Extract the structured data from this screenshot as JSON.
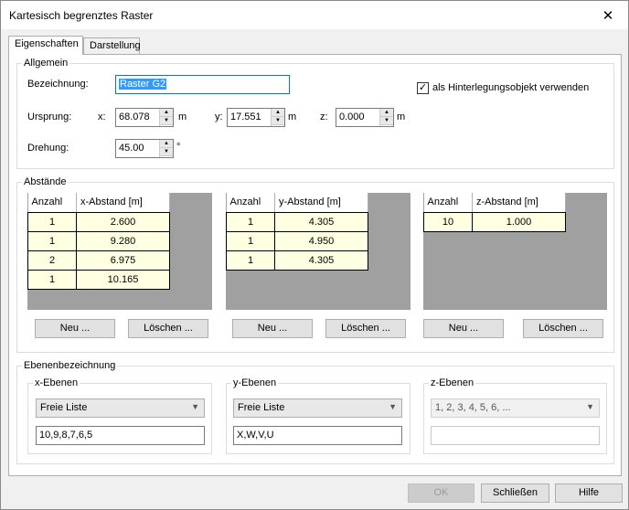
{
  "window": {
    "title": "Kartesisch begrenztes Raster"
  },
  "tabs": [
    {
      "label": "Eigenschaften"
    },
    {
      "label": "Darstellung"
    }
  ],
  "allgemein": {
    "group_label": "Allgemein",
    "bezeichnung_label": "Bezeichnung:",
    "bezeichnung_value": "Raster G2",
    "hinterlegung_label": "als Hinterlegungsobjekt verwenden",
    "hinterlegung_checked": true,
    "ursprung_label": "Ursprung:",
    "x_label": "x:",
    "x_value": "68.078",
    "x_unit": "m",
    "y_label": "y:",
    "y_value": "17.551",
    "y_unit": "m",
    "z_label": "z:",
    "z_value": "0.000",
    "z_unit": "m",
    "drehung_label": "Drehung:",
    "drehung_value": "45.00",
    "drehung_unit": "°"
  },
  "abstaende": {
    "group_label": "Abstände",
    "x": {
      "col_count": "Anzahl",
      "col_dist": "x-Abstand [m]",
      "rows": [
        [
          "1",
          "2.600"
        ],
        [
          "1",
          "9.280"
        ],
        [
          "2",
          "6.975"
        ],
        [
          "1",
          "10.165"
        ]
      ],
      "new": "Neu ...",
      "delete": "Löschen ..."
    },
    "y": {
      "col_count": "Anzahl",
      "col_dist": "y-Abstand [m]",
      "rows": [
        [
          "1",
          "4.305"
        ],
        [
          "1",
          "4.950"
        ],
        [
          "1",
          "4.305"
        ]
      ],
      "new": "Neu ...",
      "delete": "Löschen ..."
    },
    "z": {
      "col_count": "Anzahl",
      "col_dist": "z-Abstand [m]",
      "rows": [
        [
          "10",
          "1.000"
        ]
      ],
      "new": "Neu ...",
      "delete": "Löschen ..."
    }
  },
  "ebenen": {
    "group_label": "Ebenenbezeichnung",
    "x": {
      "label": "x-Ebenen",
      "combo": "Freie Liste",
      "text": "10,9,8,7,6,5"
    },
    "y": {
      "label": "y-Ebenen",
      "combo": "Freie Liste",
      "text": "X,W,V,U"
    },
    "z": {
      "label": "z-Ebenen",
      "combo": "1, 2, 3, 4, 5, 6, ...",
      "text": ""
    }
  },
  "footer": {
    "ok": "OK",
    "close": "Schließen",
    "help": "Hilfe"
  }
}
